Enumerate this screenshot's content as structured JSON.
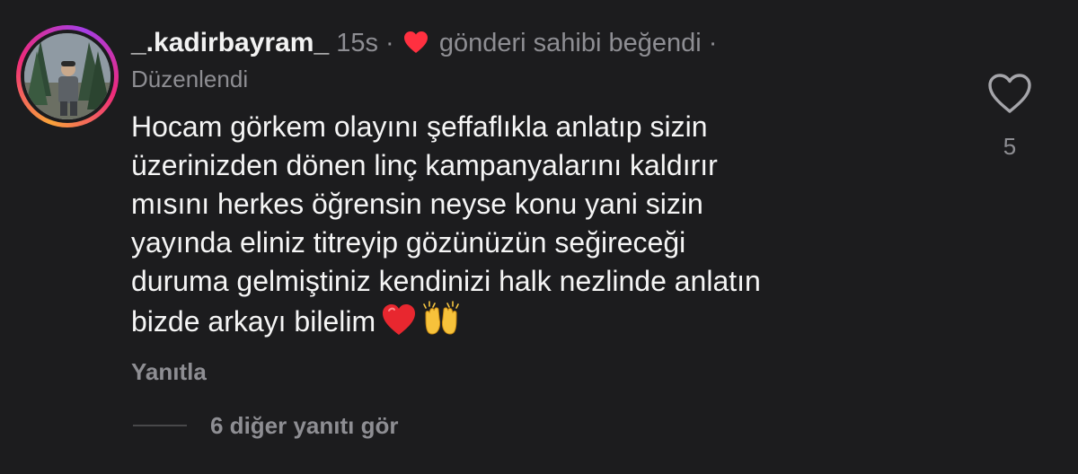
{
  "comment": {
    "username": "_.kadirbayram_",
    "time": "15s",
    "separator": "·",
    "liked_by_author": "gönderi sahibi beğendi",
    "edited_label": "Düzenlendi",
    "text": "Hocam görkem olayını şeffaflıkla anlatıp sizin\nüzerinizden dönen linç kampanyalarını kaldırır\nmısını herkes öğrensin neyse konu yani sizin\nyayında eliniz titreyip gözünüzün seğireceği\nduruma gelmiştiniz  kendinizi halk nezlinde anlatın\nbizde arkayı bilelim",
    "emojis": [
      "red-heart",
      "raising-hands"
    ],
    "reply_label": "Yanıtla",
    "view_replies_label": "6 diğer yanıtı gör",
    "like_count": "5"
  },
  "colors": {
    "background": "#1c1c1e",
    "primary_text": "#f5f5f5",
    "secondary_text": "#8e8e93",
    "like_red": "#ff3040"
  }
}
